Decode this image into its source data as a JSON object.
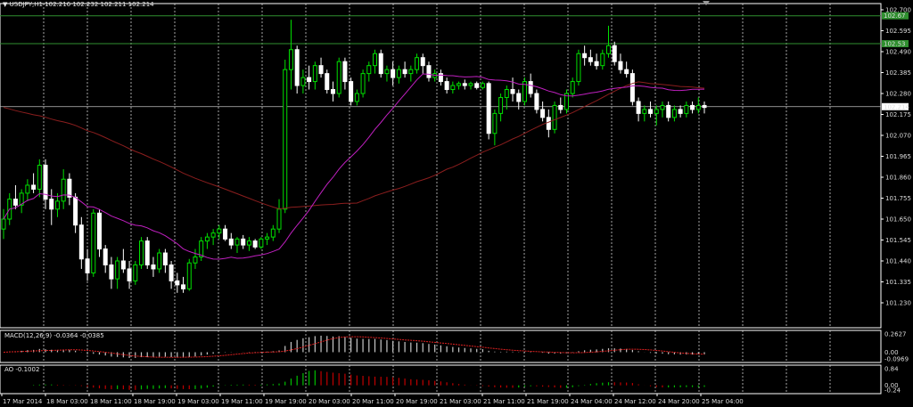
{
  "colors": {
    "background": "#000000",
    "grid": "#cfcfcf",
    "axis": "#ffffff",
    "bull_candle": "#00e000",
    "bear_candle": "#ffffff",
    "ma_fast": "#c020c0",
    "ma_slow": "#8b1e1e",
    "level_line": "#2f8f2f",
    "macd_hist": "#c8c8c8",
    "macd_signal": "#e02020",
    "ao_up": "#00c000",
    "ao_down": "#c00000"
  },
  "header": {
    "symbol_menu_icon": "triangle-down-icon",
    "title": "USDJPY,H1  102.216 102.232 102.211 102.214"
  },
  "price_axis": {
    "ticks": [
      "102.700",
      "102.595",
      "102.490",
      "102.385",
      "102.280",
      "102.175",
      "102.070",
      "101.965",
      "101.860",
      "101.755",
      "101.650",
      "101.545",
      "101.440",
      "101.335",
      "101.230"
    ],
    "current_price": "102.214",
    "level_top_label": "102.67",
    "level_bottom_label": "102.53"
  },
  "macd_panel": {
    "title": "MACD(12,26,9) -0.0364 -0.0385",
    "ticks": [
      "0.2627",
      "0.00",
      "-0.0969"
    ]
  },
  "ao_panel": {
    "title": "AO -0.1002",
    "ticks": [
      "0.84",
      "0.00",
      "-0.24"
    ]
  },
  "time_axis": {
    "labels": [
      "17 Mar 2014",
      "18 Mar 03:00",
      "18 Mar 11:00",
      "18 Mar 19:00",
      "19 Mar 03:00",
      "19 Mar 11:00",
      "19 Mar 19:00",
      "20 Mar 03:00",
      "20 Mar 11:00",
      "20 Mar 19:00",
      "21 Mar 03:00",
      "21 Mar 11:00",
      "21 Mar 19:00",
      "24 Mar 04:00",
      "24 Mar 12:00",
      "24 Mar 20:00",
      "25 Mar 04:00"
    ]
  },
  "chart_data": {
    "type": "candlestick",
    "symbol": "USDJPY",
    "timeframe": "H1",
    "ylim": [
      101.23,
      102.7
    ],
    "horizontal_levels": [
      102.67,
      102.53,
      102.214
    ],
    "candles": [
      [
        101.6,
        101.7,
        101.55,
        101.65
      ],
      [
        101.65,
        101.78,
        101.62,
        101.75
      ],
      [
        101.75,
        101.82,
        101.7,
        101.72
      ],
      [
        101.72,
        101.8,
        101.68,
        101.78
      ],
      [
        101.78,
        101.85,
        101.74,
        101.82
      ],
      [
        101.82,
        101.88,
        101.78,
        101.8
      ],
      [
        101.8,
        101.95,
        101.76,
        101.92
      ],
      [
        101.92,
        101.95,
        101.7,
        101.75
      ],
      [
        101.75,
        101.8,
        101.62,
        101.7
      ],
      [
        101.7,
        101.78,
        101.66,
        101.74
      ],
      [
        101.74,
        101.9,
        101.7,
        101.85
      ],
      [
        101.85,
        101.88,
        101.72,
        101.76
      ],
      [
        101.76,
        101.78,
        101.58,
        101.62
      ],
      [
        101.62,
        101.66,
        101.4,
        101.45
      ],
      [
        101.45,
        101.5,
        101.34,
        101.38
      ],
      [
        101.38,
        101.7,
        101.36,
        101.68
      ],
      [
        101.68,
        101.7,
        101.46,
        101.5
      ],
      [
        101.5,
        101.52,
        101.38,
        101.42
      ],
      [
        101.42,
        101.46,
        101.3,
        101.35
      ],
      [
        101.35,
        101.46,
        101.3,
        101.44
      ],
      [
        101.44,
        101.5,
        101.38,
        101.4
      ],
      [
        101.4,
        101.44,
        101.3,
        101.34
      ],
      [
        101.34,
        101.44,
        101.32,
        101.42
      ],
      [
        101.42,
        101.56,
        101.4,
        101.54
      ],
      [
        101.54,
        101.56,
        101.4,
        101.42
      ],
      [
        101.42,
        101.46,
        101.36,
        101.4
      ],
      [
        101.4,
        101.5,
        101.38,
        101.48
      ],
      [
        101.48,
        101.5,
        101.38,
        101.42
      ],
      [
        101.42,
        101.44,
        101.3,
        101.34
      ],
      [
        101.34,
        101.38,
        101.28,
        101.32
      ],
      [
        101.32,
        101.36,
        101.28,
        101.3
      ],
      [
        101.3,
        101.45,
        101.29,
        101.43
      ],
      [
        101.43,
        101.5,
        101.4,
        101.46
      ],
      [
        101.46,
        101.56,
        101.44,
        101.54
      ],
      [
        101.54,
        101.58,
        101.5,
        101.56
      ],
      [
        101.56,
        101.6,
        101.52,
        101.58
      ],
      [
        101.58,
        101.62,
        101.55,
        101.6
      ],
      [
        101.6,
        101.62,
        101.54,
        101.55
      ],
      [
        101.55,
        101.58,
        101.5,
        101.52
      ],
      [
        101.52,
        101.56,
        101.48,
        101.55
      ],
      [
        101.55,
        101.57,
        101.5,
        101.52
      ],
      [
        101.52,
        101.56,
        101.49,
        101.54
      ],
      [
        101.54,
        101.55,
        101.5,
        101.51
      ],
      [
        101.51,
        101.56,
        101.5,
        101.55
      ],
      [
        101.55,
        101.58,
        101.52,
        101.56
      ],
      [
        101.56,
        101.62,
        101.54,
        101.6
      ],
      [
        101.6,
        101.75,
        101.58,
        101.7
      ],
      [
        101.7,
        102.45,
        101.68,
        102.4
      ],
      [
        102.4,
        102.65,
        102.3,
        102.5
      ],
      [
        102.5,
        102.52,
        102.28,
        102.32
      ],
      [
        102.32,
        102.4,
        102.28,
        102.36
      ],
      [
        102.36,
        102.42,
        102.3,
        102.34
      ],
      [
        102.34,
        102.44,
        102.3,
        102.42
      ],
      [
        102.42,
        102.46,
        102.36,
        102.38
      ],
      [
        102.38,
        102.4,
        102.28,
        102.3
      ],
      [
        102.3,
        102.34,
        102.24,
        102.28
      ],
      [
        102.28,
        102.46,
        102.26,
        102.44
      ],
      [
        102.44,
        102.46,
        102.3,
        102.34
      ],
      [
        102.34,
        102.36,
        102.22,
        102.24
      ],
      [
        102.24,
        102.3,
        102.22,
        102.28
      ],
      [
        102.28,
        102.4,
        102.26,
        102.38
      ],
      [
        102.38,
        102.44,
        102.34,
        102.42
      ],
      [
        102.42,
        102.5,
        102.38,
        102.48
      ],
      [
        102.48,
        102.5,
        102.36,
        102.38
      ],
      [
        102.38,
        102.42,
        102.34,
        102.4
      ],
      [
        102.4,
        102.44,
        102.32,
        102.36
      ],
      [
        102.36,
        102.42,
        102.33,
        102.4
      ],
      [
        102.4,
        102.44,
        102.36,
        102.38
      ],
      [
        102.38,
        102.42,
        102.34,
        102.4
      ],
      [
        102.4,
        102.48,
        102.38,
        102.46
      ],
      [
        102.46,
        102.48,
        102.38,
        102.42
      ],
      [
        102.42,
        102.44,
        102.34,
        102.36
      ],
      [
        102.36,
        102.4,
        102.34,
        102.38
      ],
      [
        102.38,
        102.4,
        102.32,
        102.34
      ],
      [
        102.34,
        102.36,
        102.28,
        102.3
      ],
      [
        102.3,
        102.34,
        102.28,
        102.32
      ],
      [
        102.32,
        102.34,
        102.3,
        102.33
      ],
      [
        102.33,
        102.35,
        102.3,
        102.32
      ],
      [
        102.32,
        102.34,
        102.3,
        102.33
      ],
      [
        102.33,
        102.34,
        102.3,
        102.31
      ],
      [
        102.31,
        102.34,
        102.3,
        102.33
      ],
      [
        102.33,
        102.34,
        102.05,
        102.08
      ],
      [
        102.08,
        102.2,
        102.02,
        102.18
      ],
      [
        102.18,
        102.28,
        102.14,
        102.26
      ],
      [
        102.26,
        102.32,
        102.2,
        102.3
      ],
      [
        102.3,
        102.36,
        102.24,
        102.28
      ],
      [
        102.28,
        102.3,
        102.2,
        102.24
      ],
      [
        102.24,
        102.36,
        102.22,
        102.34
      ],
      [
        102.34,
        102.38,
        102.26,
        102.28
      ],
      [
        102.28,
        102.3,
        102.18,
        102.2
      ],
      [
        102.2,
        102.24,
        102.14,
        102.16
      ],
      [
        102.16,
        102.2,
        102.06,
        102.1
      ],
      [
        102.1,
        102.24,
        102.08,
        102.22
      ],
      [
        102.22,
        102.26,
        102.18,
        102.2
      ],
      [
        102.2,
        102.3,
        102.18,
        102.28
      ],
      [
        102.28,
        102.36,
        102.26,
        102.34
      ],
      [
        102.34,
        102.5,
        102.32,
        102.48
      ],
      [
        102.48,
        102.52,
        102.42,
        102.46
      ],
      [
        102.46,
        102.5,
        102.42,
        102.44
      ],
      [
        102.44,
        102.48,
        102.4,
        102.42
      ],
      [
        102.42,
        102.5,
        102.4,
        102.48
      ],
      [
        102.48,
        102.62,
        102.46,
        102.52
      ],
      [
        102.52,
        102.54,
        102.42,
        102.44
      ],
      [
        102.44,
        102.48,
        102.38,
        102.4
      ],
      [
        102.4,
        102.44,
        102.36,
        102.38
      ],
      [
        102.38,
        102.4,
        102.22,
        102.24
      ],
      [
        102.24,
        102.26,
        102.14,
        102.18
      ],
      [
        102.18,
        102.22,
        102.14,
        102.2
      ],
      [
        102.2,
        102.24,
        102.16,
        102.18
      ],
      [
        102.18,
        102.22,
        102.12,
        102.2
      ],
      [
        102.2,
        102.24,
        102.16,
        102.22
      ],
      [
        102.22,
        102.24,
        102.14,
        102.16
      ],
      [
        102.16,
        102.22,
        102.14,
        102.2
      ],
      [
        102.2,
        102.22,
        102.16,
        102.18
      ],
      [
        102.18,
        102.24,
        102.16,
        102.22
      ],
      [
        102.22,
        102.24,
        102.18,
        102.2
      ],
      [
        102.2,
        102.26,
        102.18,
        102.22
      ],
      [
        102.22,
        102.24,
        102.18,
        102.21
      ]
    ]
  }
}
